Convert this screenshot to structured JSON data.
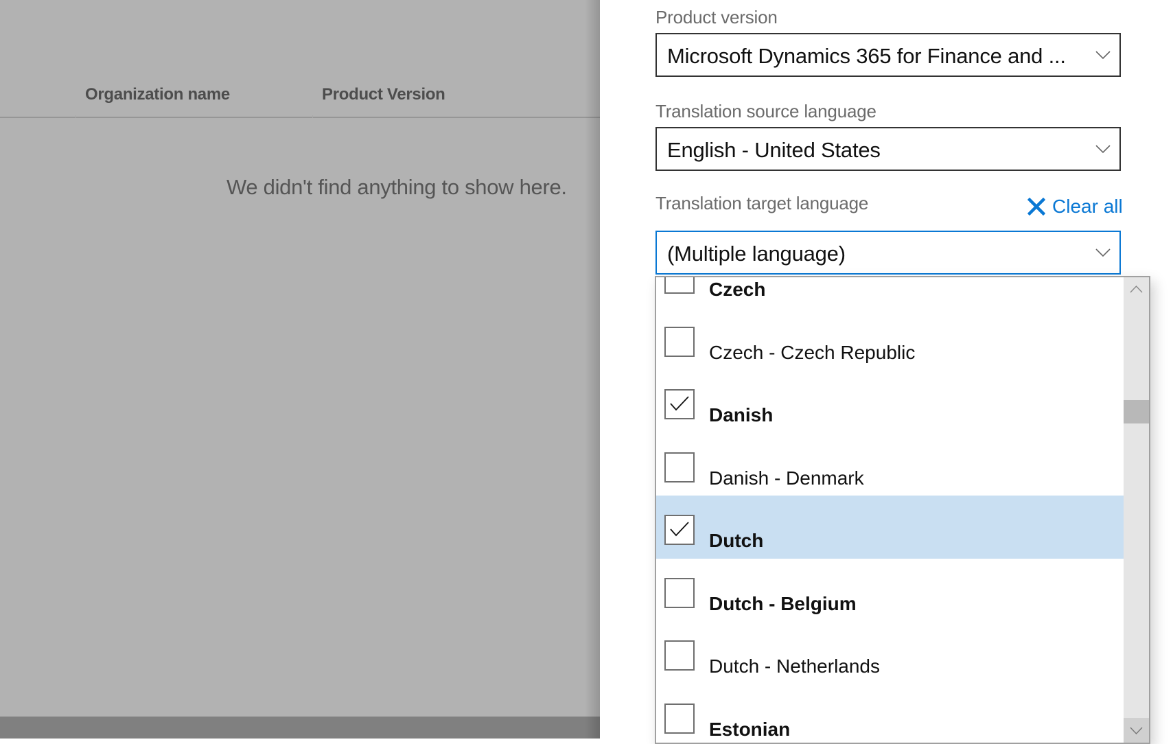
{
  "background": {
    "columns": [
      "Organization name",
      "Product Version"
    ],
    "empty_message": "We didn't find anything to show here."
  },
  "panel": {
    "product_version": {
      "label": "Product version",
      "value": "Microsoft Dynamics 365 for Finance and ..."
    },
    "source_language": {
      "label": "Translation source language",
      "value": "English - United States"
    },
    "target_language": {
      "label": "Translation target language",
      "value": "(Multiple language)",
      "clear_all_label": "Clear all"
    },
    "options": [
      {
        "label": "Czech",
        "checked": false,
        "bold": true,
        "highlighted": false
      },
      {
        "label": "Czech - Czech Republic",
        "checked": false,
        "bold": false,
        "highlighted": false
      },
      {
        "label": "Danish",
        "checked": true,
        "bold": true,
        "highlighted": false
      },
      {
        "label": "Danish - Denmark",
        "checked": false,
        "bold": false,
        "highlighted": false
      },
      {
        "label": "Dutch",
        "checked": true,
        "bold": true,
        "highlighted": true
      },
      {
        "label": "Dutch - Belgium",
        "checked": false,
        "bold": true,
        "highlighted": false
      },
      {
        "label": "Dutch - Netherlands",
        "checked": false,
        "bold": false,
        "highlighted": false
      },
      {
        "label": "Estonian",
        "checked": false,
        "bold": true,
        "highlighted": false
      }
    ],
    "list_scroll_position": 0.25
  },
  "colors": {
    "accent": "#0a78d4",
    "highlight_row": "#c9dff2",
    "overlay": "#b2b2b2"
  }
}
